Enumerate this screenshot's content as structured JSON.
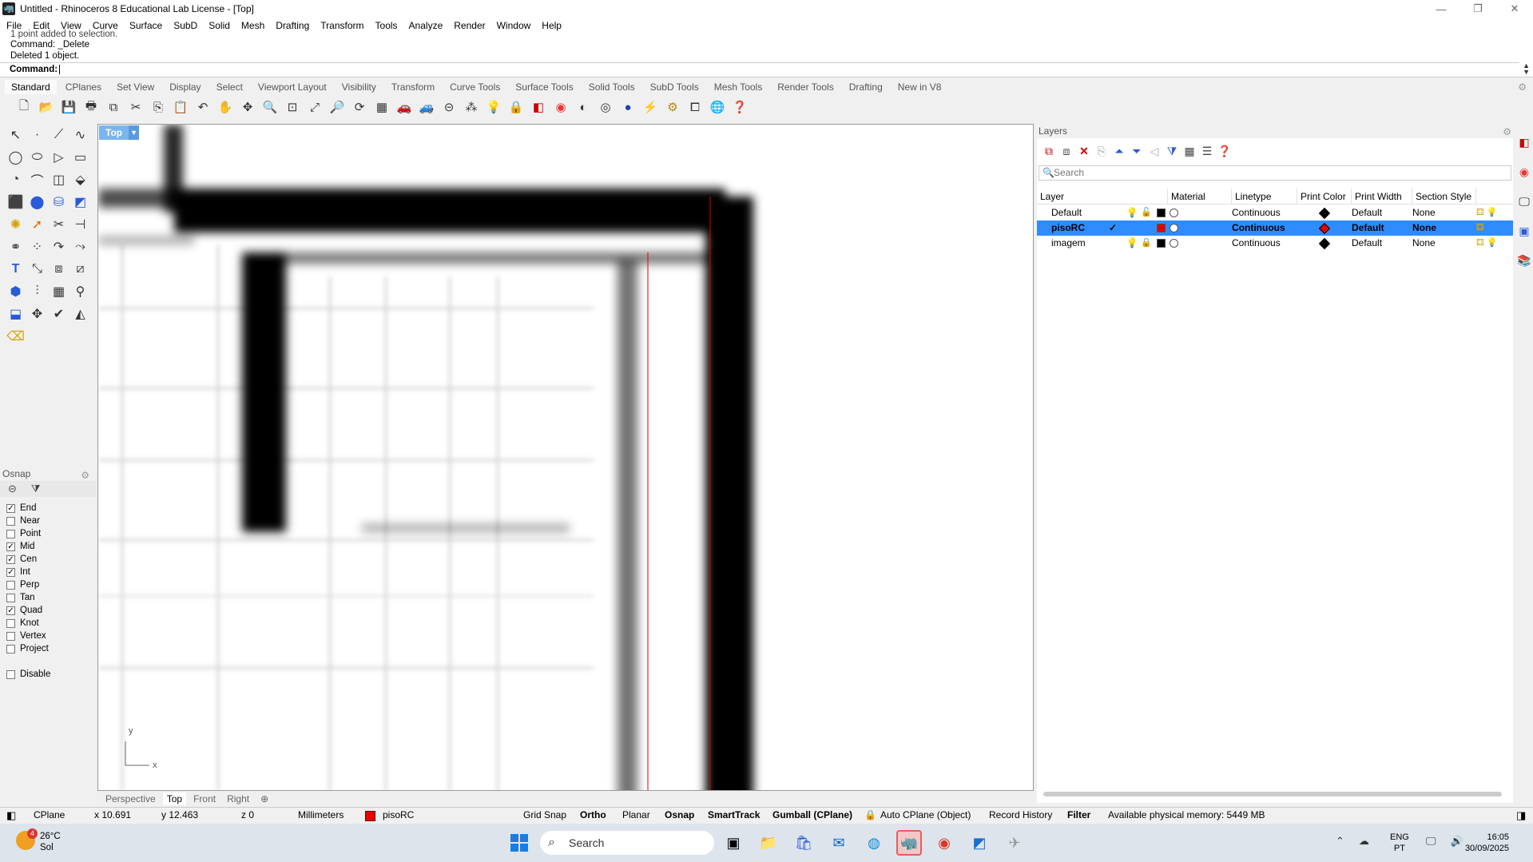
{
  "window": {
    "title": "Untitled - Rhinoceros 8 Educational Lab License - [Top]"
  },
  "menu": [
    "File",
    "Edit",
    "View",
    "Curve",
    "Surface",
    "SubD",
    "Solid",
    "Mesh",
    "Drafting",
    "Transform",
    "Tools",
    "Analyze",
    "Render",
    "Window",
    "Help"
  ],
  "command": {
    "history": [
      "1 point added to selection.",
      "Command: _Delete",
      "Deleted 1 object."
    ],
    "prompt": "Command:"
  },
  "toolbar_tabs": [
    "Standard",
    "CPlanes",
    "Set View",
    "Display",
    "Select",
    "Viewport Layout",
    "Visibility",
    "Transform",
    "Curve Tools",
    "Surface Tools",
    "Solid Tools",
    "SubD Tools",
    "Mesh Tools",
    "Render Tools",
    "Drafting",
    "New in V8"
  ],
  "toolbar_tabs_active": "Standard",
  "viewport": {
    "name": "Top",
    "axis_x": "x",
    "axis_y": "y"
  },
  "viewport_tabs": [
    "Perspective",
    "Top",
    "Front",
    "Right"
  ],
  "viewport_tabs_active": "Top",
  "osnap": {
    "title": "Osnap",
    "items": [
      {
        "label": "End",
        "checked": true
      },
      {
        "label": "Near",
        "checked": false
      },
      {
        "label": "Point",
        "checked": false
      },
      {
        "label": "Mid",
        "checked": true
      },
      {
        "label": "Cen",
        "checked": true
      },
      {
        "label": "Int",
        "checked": true
      },
      {
        "label": "Perp",
        "checked": false
      },
      {
        "label": "Tan",
        "checked": false
      },
      {
        "label": "Quad",
        "checked": true
      },
      {
        "label": "Knot",
        "checked": false
      },
      {
        "label": "Vertex",
        "checked": false
      },
      {
        "label": "Project",
        "checked": false
      }
    ],
    "disable": {
      "label": "Disable",
      "checked": false
    }
  },
  "layers": {
    "title": "Layers",
    "search_placeholder": "Search",
    "columns": [
      "Layer",
      "Material",
      "Linetype",
      "Print Color",
      "Print Width",
      "Section Style"
    ],
    "rows": [
      {
        "name": "Default",
        "linetype": "Continuous",
        "print_width": "Default",
        "section_style": "None",
        "color": "#000000",
        "print_color": "#000000",
        "current": false,
        "locked": false,
        "selected": false
      },
      {
        "name": "pisoRC",
        "linetype": "Continuous",
        "print_width": "Default",
        "section_style": "None",
        "color": "#e00000",
        "print_color": "#e00000",
        "current": true,
        "locked": false,
        "selected": true
      },
      {
        "name": "imagem",
        "linetype": "Continuous",
        "print_width": "Default",
        "section_style": "None",
        "color": "#000000",
        "print_color": "#000000",
        "current": false,
        "locked": true,
        "selected": false
      }
    ]
  },
  "status": {
    "cplane": "CPlane",
    "x": "x 10.691",
    "y": "y 12.463",
    "z": "z 0",
    "units": "Millimeters",
    "layer": "pisoRC",
    "layer_color": "#e00000",
    "grid_snap": "Grid Snap",
    "ortho": "Ortho",
    "planar": "Planar",
    "osnap": "Osnap",
    "smarttrack": "SmartTrack",
    "gumball": "Gumball (CPlane)",
    "auto_cplane": "Auto CPlane (Object)",
    "record_history": "Record History",
    "filter": "Filter",
    "memory": "Available physical memory: 5449 MB"
  },
  "taskbar": {
    "weather_temp": "26°C",
    "weather_desc": "Sol",
    "weather_badge": "4",
    "search_placeholder": "Search",
    "lang1": "ENG",
    "lang2": "PT",
    "time": "16:05",
    "date": "30/09/2025"
  },
  "colors": {
    "selection": "#2e8cff",
    "viewport_label": "#7ab5ef"
  }
}
